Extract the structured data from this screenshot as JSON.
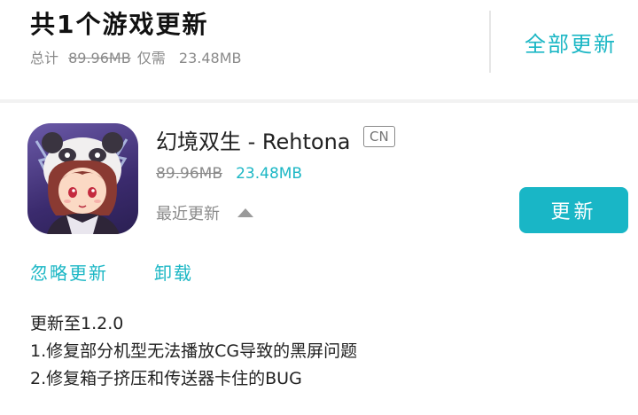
{
  "header": {
    "title": "共1个游戏更新",
    "total_label": "总计",
    "total_old_size": "89.96MB",
    "only_need_label": "仅需",
    "total_new_size": "23.48MB",
    "update_all_label": "全部更新"
  },
  "app": {
    "name": "幻境双生 - Rehtona",
    "region_badge": "CN",
    "old_size": "89.96MB",
    "new_size": "23.48MB",
    "recent_update_label": "最近更新",
    "update_button_label": "更新",
    "ignore_label": "忽略更新",
    "uninstall_label": "卸载",
    "release_notes": {
      "heading": "更新至1.2.0",
      "lines": [
        "1.修复部分机型无法播放CG导致的黑屏问题",
        "2.修复箱子挤压和传送器卡住的BUG"
      ]
    }
  },
  "colors": {
    "accent": "#1cb7c5",
    "button_bg": "#19b6c6",
    "muted_text": "#8a8a8a"
  },
  "icons": {
    "collapse": "chevron-up-icon",
    "app_icon": "app-icon-rehtona"
  }
}
